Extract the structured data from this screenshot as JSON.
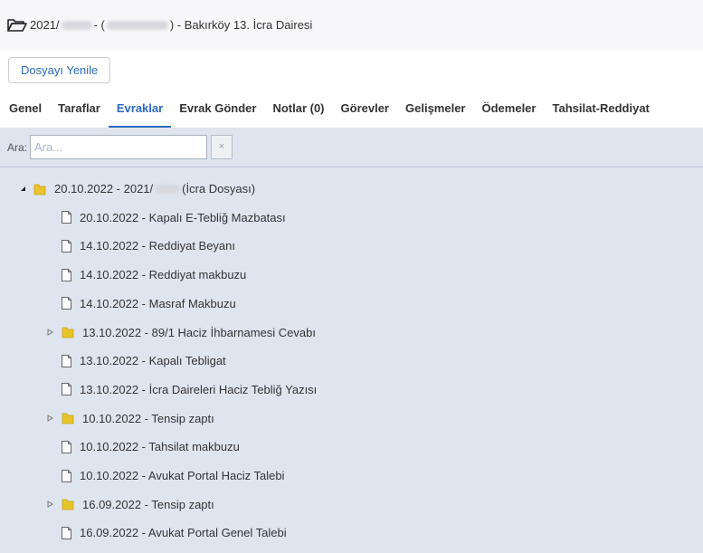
{
  "header": {
    "year_prefix": "2021/",
    "separator": " - (",
    "suffix": ") - Bakırköy 13. İcra Dairesi"
  },
  "toolbar": {
    "refresh_label": "Dosyayı Yenile"
  },
  "tabs": [
    {
      "label": "Genel"
    },
    {
      "label": "Taraflar"
    },
    {
      "label": "Evraklar",
      "active": true
    },
    {
      "label": "Evrak Gönder"
    },
    {
      "label": "Notlar (0)"
    },
    {
      "label": "Görevler"
    },
    {
      "label": "Gelişmeler"
    },
    {
      "label": "Ödemeler"
    },
    {
      "label": "Tahsilat-Reddiyat"
    }
  ],
  "search": {
    "label": "Ara:",
    "placeholder": "Ara...",
    "clear_symbol": "×"
  },
  "tree": {
    "root": {
      "label_prefix": "20.10.2022 - 2021/",
      "label_suffix": " (İcra Dosyası)",
      "expanded": true
    },
    "children": [
      {
        "type": "file",
        "label": "20.10.2022 - Kapalı E-Tebliğ Mazbatası"
      },
      {
        "type": "file",
        "label": "14.10.2022 - Reddiyat Beyanı"
      },
      {
        "type": "file",
        "label": "14.10.2022 - Reddiyat makbuzu"
      },
      {
        "type": "file",
        "label": "14.10.2022 - Masraf Makbuzu"
      },
      {
        "type": "folder",
        "label": "13.10.2022 - 89/1 Haciz İhbarnamesi Cevabı"
      },
      {
        "type": "file",
        "label": "13.10.2022 - Kapalı Tebligat"
      },
      {
        "type": "file",
        "label": "13.10.2022 - İcra Daireleri Haciz Tebliğ Yazısı"
      },
      {
        "type": "folder",
        "label": "10.10.2022 - Tensip zaptı"
      },
      {
        "type": "file",
        "label": "10.10.2022 - Tahsilat makbuzu"
      },
      {
        "type": "file",
        "label": "10.10.2022 - Avukat Portal Haciz Talebi"
      },
      {
        "type": "folder",
        "label": "16.09.2022 - Tensip zaptı"
      },
      {
        "type": "file",
        "label": "16.09.2022 - Avukat Portal Genel Talebi"
      }
    ]
  },
  "colors": {
    "accent": "#2c6bbf",
    "panel": "#dfe5ef",
    "folder": "#e8c42a"
  }
}
